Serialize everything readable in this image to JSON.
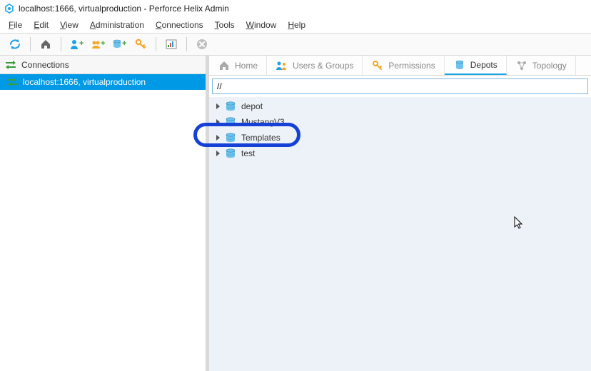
{
  "window": {
    "title": "localhost:1666,  virtualproduction - Perforce Helix Admin"
  },
  "menu": {
    "file": "File",
    "edit": "Edit",
    "view": "View",
    "administration": "Administration",
    "connections": "Connections",
    "tools": "Tools",
    "window": "Window",
    "help": "Help"
  },
  "left": {
    "header": "Connections",
    "items": [
      "localhost:1666,  virtualproduction"
    ]
  },
  "tabs": {
    "home": "Home",
    "users": "Users & Groups",
    "permissions": "Permissions",
    "depots": "Depots",
    "topology": "Topology"
  },
  "path": {
    "value": "//"
  },
  "depots": [
    "depot",
    "MustangV3",
    "Templates",
    "test"
  ],
  "highlight_index": 2
}
